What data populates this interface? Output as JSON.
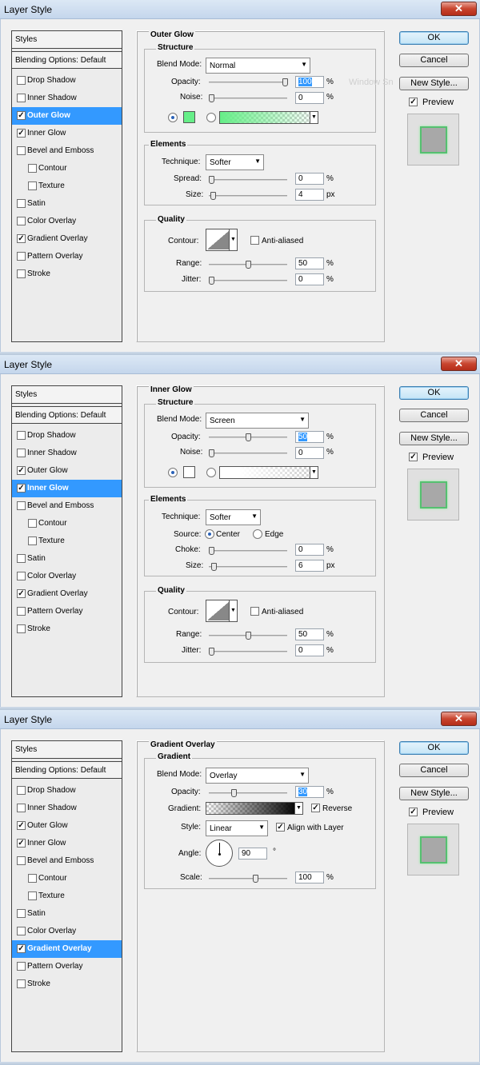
{
  "windows": [
    {
      "title": "Layer Style",
      "close": "✕",
      "section": "Outer Glow",
      "watermark": "Window Sn",
      "list_header": "Styles",
      "blending": "Blending Options: Default",
      "items": [
        {
          "label": "Drop Shadow",
          "checked": false
        },
        {
          "label": "Inner Shadow",
          "checked": false
        },
        {
          "label": "Outer Glow",
          "checked": true,
          "selected": true
        },
        {
          "label": "Inner Glow",
          "checked": true
        },
        {
          "label": "Bevel and Emboss",
          "checked": false
        },
        {
          "label": "Contour",
          "checked": false,
          "sub": true
        },
        {
          "label": "Texture",
          "checked": false,
          "sub": true
        },
        {
          "label": "Satin",
          "checked": false
        },
        {
          "label": "Color Overlay",
          "checked": false
        },
        {
          "label": "Gradient Overlay",
          "checked": true
        },
        {
          "label": "Pattern Overlay",
          "checked": false
        },
        {
          "label": "Stroke",
          "checked": false
        }
      ],
      "buttons": {
        "ok": "OK",
        "cancel": "Cancel",
        "new_style": "New Style...",
        "preview": "Preview"
      },
      "structure": {
        "title": "Structure",
        "blend_mode_label": "Blend Mode:",
        "blend_mode": "Normal",
        "opacity_label": "Opacity:",
        "opacity": "100",
        "noise_label": "Noise:",
        "noise": "0",
        "unit": "%"
      },
      "elements": {
        "title": "Elements",
        "technique_label": "Technique:",
        "technique": "Softer",
        "spread_label": "Spread:",
        "spread": "0",
        "size_label": "Size:",
        "size": "4",
        "px": "px"
      },
      "quality": {
        "title": "Quality",
        "contour_label": "Contour:",
        "anti_aliased": "Anti-aliased",
        "range_label": "Range:",
        "range": "50",
        "jitter_label": "Jitter:",
        "jitter": "0"
      },
      "colors": {
        "glow": "#66ee88"
      }
    },
    {
      "title": "Layer Style",
      "close": "✕",
      "section": "Inner Glow",
      "list_header": "Styles",
      "blending": "Blending Options: Default",
      "items": [
        {
          "label": "Drop Shadow",
          "checked": false
        },
        {
          "label": "Inner Shadow",
          "checked": false
        },
        {
          "label": "Outer Glow",
          "checked": true
        },
        {
          "label": "Inner Glow",
          "checked": true,
          "selected": true
        },
        {
          "label": "Bevel and Emboss",
          "checked": false
        },
        {
          "label": "Contour",
          "checked": false,
          "sub": true
        },
        {
          "label": "Texture",
          "checked": false,
          "sub": true
        },
        {
          "label": "Satin",
          "checked": false
        },
        {
          "label": "Color Overlay",
          "checked": false
        },
        {
          "label": "Gradient Overlay",
          "checked": true
        },
        {
          "label": "Pattern Overlay",
          "checked": false
        },
        {
          "label": "Stroke",
          "checked": false
        }
      ],
      "buttons": {
        "ok": "OK",
        "cancel": "Cancel",
        "new_style": "New Style...",
        "preview": "Preview"
      },
      "structure": {
        "title": "Structure",
        "blend_mode_label": "Blend Mode:",
        "blend_mode": "Screen",
        "opacity_label": "Opacity:",
        "opacity": "50",
        "noise_label": "Noise:",
        "noise": "0",
        "unit": "%"
      },
      "elements": {
        "title": "Elements",
        "technique_label": "Technique:",
        "technique": "Softer",
        "source_label": "Source:",
        "center": "Center",
        "edge": "Edge",
        "choke_label": "Choke:",
        "choke": "0",
        "size_label": "Size:",
        "size": "6",
        "px": "px"
      },
      "quality": {
        "title": "Quality",
        "contour_label": "Contour:",
        "anti_aliased": "Anti-aliased",
        "range_label": "Range:",
        "range": "50",
        "jitter_label": "Jitter:",
        "jitter": "0"
      },
      "colors": {
        "glow": "#ffffff"
      }
    },
    {
      "title": "Layer Style",
      "close": "✕",
      "section": "Gradient Overlay",
      "list_header": "Styles",
      "blending": "Blending Options: Default",
      "items": [
        {
          "label": "Drop Shadow",
          "checked": false
        },
        {
          "label": "Inner Shadow",
          "checked": false
        },
        {
          "label": "Outer Glow",
          "checked": true
        },
        {
          "label": "Inner Glow",
          "checked": true
        },
        {
          "label": "Bevel and Emboss",
          "checked": false
        },
        {
          "label": "Contour",
          "checked": false,
          "sub": true
        },
        {
          "label": "Texture",
          "checked": false,
          "sub": true
        },
        {
          "label": "Satin",
          "checked": false
        },
        {
          "label": "Color Overlay",
          "checked": false
        },
        {
          "label": "Gradient Overlay",
          "checked": true,
          "selected": true
        },
        {
          "label": "Pattern Overlay",
          "checked": false
        },
        {
          "label": "Stroke",
          "checked": false
        }
      ],
      "buttons": {
        "ok": "OK",
        "cancel": "Cancel",
        "new_style": "New Style...",
        "preview": "Preview"
      },
      "gradient": {
        "title": "Gradient",
        "blend_mode_label": "Blend Mode:",
        "blend_mode": "Overlay",
        "opacity_label": "Opacity:",
        "opacity": "30",
        "unit": "%",
        "gradient_label": "Gradient:",
        "reverse": "Reverse",
        "style_label": "Style:",
        "style": "Linear",
        "align": "Align with Layer",
        "angle_label": "Angle:",
        "angle": "90",
        "degree": "°",
        "scale_label": "Scale:",
        "scale": "100"
      }
    }
  ],
  "levels": {
    "w0_opacity": 1.0,
    "w0_noise": 0,
    "w0_spread": 0,
    "w0_size": 0.02,
    "w0_range": 0.5,
    "w0_jitter": 0,
    "w1_opacity": 0.5,
    "w1_noise": 0,
    "w1_choke": 0,
    "w1_size": 0.03,
    "w1_range": 0.5,
    "w1_jitter": 0,
    "w2_opacity": 0.3,
    "w2_scale": 0.6
  }
}
